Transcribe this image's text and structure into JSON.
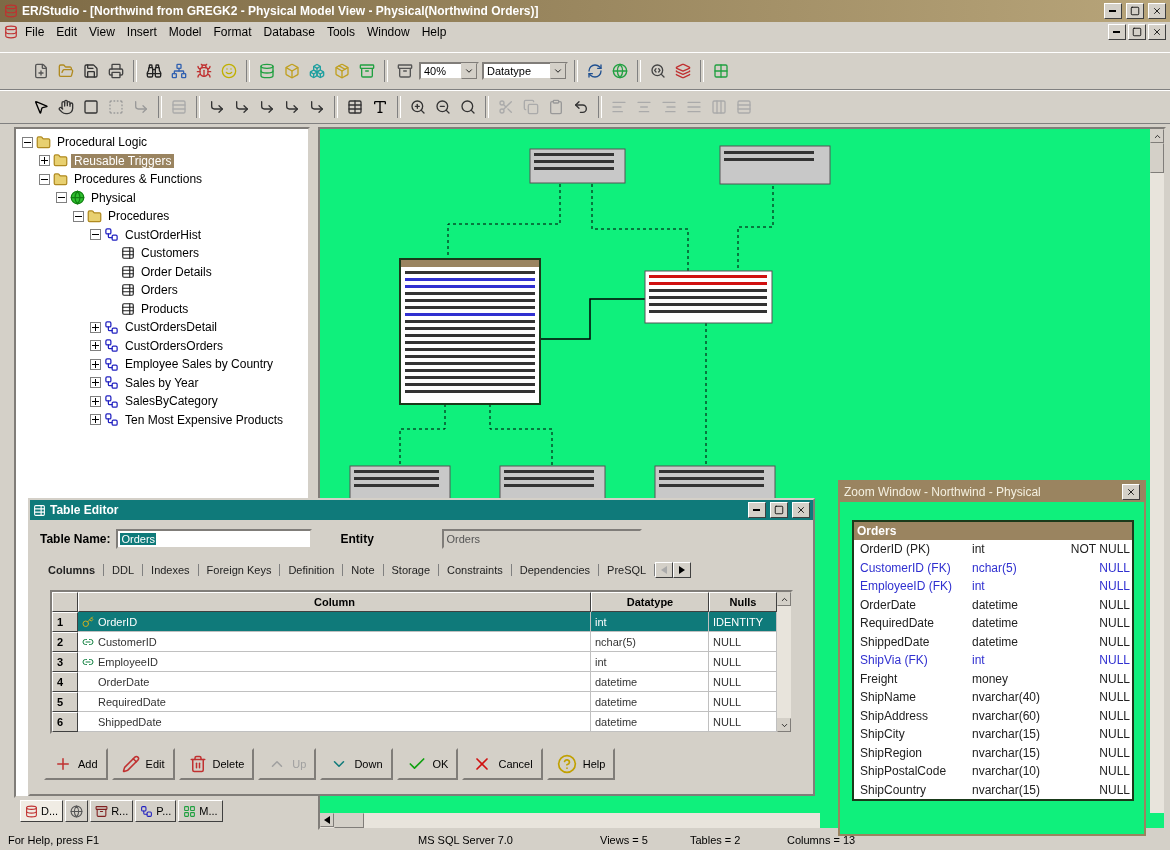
{
  "window": {
    "title": "ER/Studio - [Northwind from GREGK2 - Physical Model View - Physical(Northwind Orders)]"
  },
  "menu": [
    "File",
    "Edit",
    "View",
    "Insert",
    "Model",
    "Format",
    "Database",
    "Tools",
    "Window",
    "Help"
  ],
  "toolbar": {
    "zoom": "40%",
    "display": "Datatype"
  },
  "tree": [
    {
      "label": "Procedural Logic",
      "kind": "folder",
      "selected": false,
      "expanded": true,
      "children": [
        {
          "label": "Reusable Triggers",
          "kind": "folder",
          "selected": true,
          "expanded": false
        },
        {
          "label": "Procedures & Functions",
          "kind": "folder",
          "selected": false,
          "expanded": true,
          "children": [
            {
              "label": "Physical",
              "kind": "model",
              "selected": false,
              "expanded": true,
              "children": [
                {
                  "label": "Procedures",
                  "kind": "folder",
                  "selected": false,
                  "expanded": true,
                  "children": [
                    {
                      "label": "CustOrderHist",
                      "kind": "procedure",
                      "selected": false,
                      "expanded": true,
                      "children": [
                        {
                          "label": "Customers",
                          "kind": "table",
                          "selected": false
                        },
                        {
                          "label": "Order Details",
                          "kind": "table",
                          "selected": false
                        },
                        {
                          "label": "Orders",
                          "kind": "table",
                          "selected": false
                        },
                        {
                          "label": "Products",
                          "kind": "table",
                          "selected": false
                        }
                      ]
                    },
                    {
                      "label": "CustOrdersDetail",
                      "kind": "procedure",
                      "selected": false,
                      "expanded": false
                    },
                    {
                      "label": "CustOrdersOrders",
                      "kind": "procedure",
                      "selected": false,
                      "expanded": false
                    },
                    {
                      "label": "Employee Sales by Country",
                      "kind": "procedure",
                      "selected": false,
                      "expanded": false
                    },
                    {
                      "label": "Sales by Year",
                      "kind": "procedure",
                      "selected": false,
                      "expanded": false
                    },
                    {
                      "label": "SalesByCategory",
                      "kind": "procedure",
                      "selected": false,
                      "expanded": false
                    },
                    {
                      "label": "Ten Most Expensive Products",
                      "kind": "procedure",
                      "selected": false,
                      "expanded": false
                    }
                  ]
                }
              ]
            }
          ]
        }
      ]
    }
  ],
  "bottom_tabs": [
    {
      "label": "D...",
      "kind": "data",
      "selected": true
    },
    {
      "kind": "globe",
      "selected": false
    },
    {
      "label": "R...",
      "kind": "repository",
      "selected": false
    },
    {
      "label": "P...",
      "kind": "procedure",
      "selected": false
    },
    {
      "label": "M...",
      "kind": "macro",
      "selected": false
    }
  ],
  "table_editor": {
    "title": "Table Editor",
    "table_name_label": "Table Name:",
    "table_name": "Orders",
    "entity_label": "Entity",
    "entity": "Orders",
    "tabs": [
      {
        "label": "Columns",
        "selected": true
      },
      {
        "label": "DDL",
        "selected": false
      },
      {
        "label": "Indexes",
        "selected": false
      },
      {
        "label": "Foreign Keys",
        "selected": false
      },
      {
        "label": "Definition",
        "selected": false
      },
      {
        "label": "Note",
        "selected": false
      },
      {
        "label": "Storage",
        "selected": false
      },
      {
        "label": "Constraints",
        "selected": false
      },
      {
        "label": "Dependencies",
        "selected": false
      },
      {
        "label": "PreSQL",
        "selected": false
      }
    ],
    "columns": [
      "Column",
      "Datatype",
      "Nulls"
    ],
    "rows": [
      {
        "number": "1",
        "kind": "primary",
        "name": "OrderID",
        "datatype": "int",
        "nulls": "IDENTITY",
        "selected": true
      },
      {
        "number": "2",
        "kind": "foreign",
        "name": "CustomerID",
        "datatype": "nchar(5)",
        "nulls": "NULL",
        "selected": false
      },
      {
        "number": "3",
        "kind": "foreign",
        "name": "EmployeeID",
        "datatype": "int",
        "nulls": "NULL",
        "selected": false
      },
      {
        "number": "4",
        "kind": "plain",
        "name": "OrderDate",
        "datatype": "datetime",
        "nulls": "NULL",
        "selected": false
      },
      {
        "number": "5",
        "kind": "plain",
        "name": "RequiredDate",
        "datatype": "datetime",
        "nulls": "NULL",
        "selected": false
      },
      {
        "number": "6",
        "kind": "plain",
        "name": "ShippedDate",
        "datatype": "datetime",
        "nulls": "NULL",
        "selected": false
      }
    ],
    "buttons": [
      {
        "label": "Add",
        "kind": "add",
        "disabled": false
      },
      {
        "label": "Edit",
        "kind": "edit",
        "disabled": false
      },
      {
        "label": "Delete",
        "kind": "delete",
        "disabled": false
      },
      {
        "label": "Up",
        "kind": "up",
        "disabled": true
      },
      {
        "label": "Down",
        "kind": "down",
        "disabled": false
      },
      {
        "label": "OK",
        "kind": "ok",
        "disabled": false
      },
      {
        "label": "Cancel",
        "kind": "cancel",
        "disabled": false
      },
      {
        "label": "Help",
        "kind": "help",
        "disabled": false
      }
    ]
  },
  "zoom_window": {
    "title": "Zoom Window - Northwind - Physical",
    "entity": "Orders",
    "rows": [
      {
        "name": "OrderID (PK)",
        "type": "int",
        "nulls": "NOT NULL",
        "fk": false
      },
      {
        "name": "CustomerID (FK)",
        "type": "nchar(5)",
        "nulls": "NULL",
        "fk": true
      },
      {
        "name": "EmployeeID (FK)",
        "type": "int",
        "nulls": "NULL",
        "fk": true
      },
      {
        "name": "OrderDate",
        "type": "datetime",
        "nulls": "NULL",
        "fk": false
      },
      {
        "name": "RequiredDate",
        "type": "datetime",
        "nulls": "NULL",
        "fk": false
      },
      {
        "name": "ShippedDate",
        "type": "datetime",
        "nulls": "NULL",
        "fk": false
      },
      {
        "name": "ShipVia (FK)",
        "type": "int",
        "nulls": "NULL",
        "fk": true
      },
      {
        "name": "Freight",
        "type": "money",
        "nulls": "NULL",
        "fk": false
      },
      {
        "name": "ShipName",
        "type": "nvarchar(40)",
        "nulls": "NULL",
        "fk": false
      },
      {
        "name": "ShipAddress",
        "type": "nvarchar(60)",
        "nulls": "NULL",
        "fk": false
      },
      {
        "name": "ShipCity",
        "type": "nvarchar(15)",
        "nulls": "NULL",
        "fk": false
      },
      {
        "name": "ShipRegion",
        "type": "nvarchar(15)",
        "nulls": "NULL",
        "fk": false
      },
      {
        "name": "ShipPostalCode",
        "type": "nvarchar(10)",
        "nulls": "NULL",
        "fk": false
      },
      {
        "name": "ShipCountry",
        "type": "nvarchar(15)",
        "nulls": "NULL",
        "fk": false
      }
    ]
  },
  "status_bar": [
    "For Help, press F1",
    "MS SQL Server 7.0",
    "Views = 5",
    "Tables = 2",
    "Columns = 13"
  ]
}
